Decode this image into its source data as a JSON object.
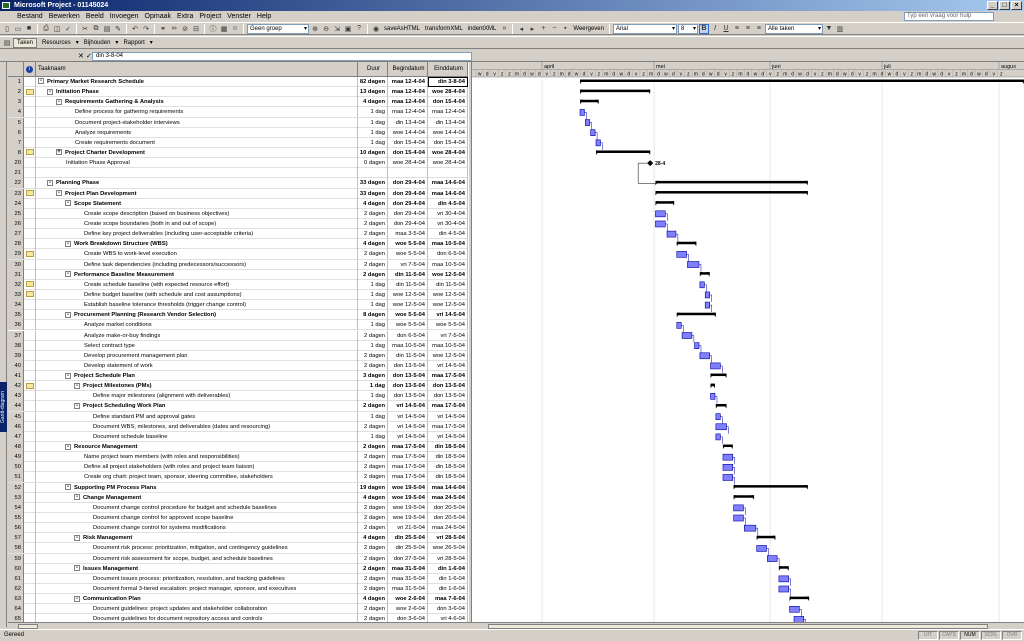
{
  "window": {
    "title": "Microsoft Project - 01145024"
  },
  "menu": [
    "Bestand",
    "Bewerken",
    "Beeld",
    "Invoegen",
    "Opmaak",
    "Extra",
    "Project",
    "Venster",
    "Help"
  ],
  "help_placeholder": "Typ een vraag voor hulp",
  "toolbar": {
    "group_combo": "Geen groep",
    "macros": [
      "saveAsHTML",
      "transformXML",
      "indentXML"
    ],
    "show_label": "Weergeven",
    "font": "Arial",
    "size": "8",
    "filter_combo": "Alle taken"
  },
  "view_toolbar": [
    "Taken",
    "Resources",
    "Bijhouden",
    "Rapport"
  ],
  "edit_value": "din 3-8-04",
  "view_label": "Gantt-diagram",
  "columns": {
    "name": "Taaknaam",
    "duration": "Duur",
    "start": "Begindatum",
    "finish": "Einddatum"
  },
  "timescale": {
    "months": [
      "april",
      "mei",
      "juni",
      "juli",
      "augus"
    ],
    "days": [
      "w",
      "d",
      "v",
      "z",
      "z",
      "m",
      "d",
      "w",
      "d",
      "v",
      "z",
      "m",
      "d",
      "w",
      "d",
      "v",
      "z",
      "m",
      "d",
      "w",
      "d",
      "v",
      "z",
      "m",
      "d",
      "w",
      "d",
      "v",
      "z",
      "m",
      "d",
      "w",
      "d",
      "v",
      "z",
      "m",
      "d",
      "w",
      "d",
      "v",
      "z",
      "m",
      "d",
      "w",
      "d",
      "v",
      "z",
      "m",
      "d",
      "w",
      "d",
      "v",
      "z",
      "m",
      "d",
      "w",
      "d",
      "v",
      "z",
      "m",
      "d",
      "w",
      "d",
      "v",
      "z",
      "m",
      "d",
      "w",
      "d",
      "v",
      "z"
    ]
  },
  "tasks": [
    {
      "id": "1",
      "lvl": 0,
      "sum": true,
      "tog": "-",
      "name": "Primary Market Research Schedule",
      "dur": "82 dagen",
      "start": "maa 12-4-04",
      "finish": "din 3-8-04",
      "sel": true,
      "b": 0,
      "e": 1.0
    },
    {
      "id": "2",
      "lvl": 1,
      "sum": true,
      "tog": "-",
      "note": true,
      "name": "Initiation Phase",
      "dur": "13 dagen",
      "start": "maa 12-4-04",
      "finish": "woe 28-4-04",
      "b": 0,
      "e": 0.158
    },
    {
      "id": "3",
      "lvl": 2,
      "sum": true,
      "tog": "-",
      "name": "Requirements Gathering & Analysis",
      "dur": "4 dagen",
      "start": "maa 12-4-04",
      "finish": "don 15-4-04",
      "b": 0,
      "e": 0.042
    },
    {
      "id": "4",
      "lvl": 3,
      "name": "Define process for gathering requirements",
      "dur": "1 dag",
      "start": "maa 12-4-04",
      "finish": "maa 12-4-04",
      "b": 0,
      "e": 0.01
    },
    {
      "id": "5",
      "lvl": 3,
      "name": "Document project-stakeholder interviews",
      "dur": "1 dag",
      "start": "din 13-4-04",
      "finish": "din 13-4-04",
      "b": 0.012,
      "e": 0.022
    },
    {
      "id": "6",
      "lvl": 3,
      "name": "Analyze requirements",
      "dur": "1 dag",
      "start": "woe 14-4-04",
      "finish": "woe 14-4-04",
      "b": 0.024,
      "e": 0.034
    },
    {
      "id": "7",
      "lvl": 3,
      "name": "Create requirements document",
      "dur": "1 dag",
      "start": "don 15-4-04",
      "finish": "don 15-4-04",
      "b": 0.036,
      "e": 0.046
    },
    {
      "id": "8",
      "lvl": 2,
      "sum": true,
      "tog": "+",
      "note": true,
      "name": "Project Charter Development",
      "dur": "10 dagen",
      "start": "don 15-4-04",
      "finish": "woe 28-4-04",
      "b": 0.036,
      "e": 0.158
    },
    {
      "id": "20",
      "lvl": 2,
      "name": "Initiation Phase Approval",
      "dur": "0 dagen",
      "start": "woe 28-4-04",
      "finish": "woe 28-4-04",
      "milestone": true,
      "mlabel": "28-4",
      "b": 0.158,
      "e": 0.158
    },
    {
      "id": "21",
      "lvl": 0,
      "name": "",
      "dur": "",
      "start": "",
      "finish": ""
    },
    {
      "id": "22",
      "lvl": 1,
      "sum": true,
      "tog": "-",
      "name": "Planning Phase",
      "dur": "33 dagen",
      "start": "don 29-4-04",
      "finish": "maa 14-6-04",
      "b": 0.17,
      "e": 0.513
    },
    {
      "id": "23",
      "lvl": 2,
      "sum": true,
      "tog": "-",
      "note": true,
      "name": "Project Plan Development",
      "dur": "33 dagen",
      "start": "don 29-4-04",
      "finish": "maa 14-6-04",
      "b": 0.17,
      "e": 0.513
    },
    {
      "id": "24",
      "lvl": 3,
      "sum": true,
      "tog": "-",
      "name": "Scope Statement",
      "dur": "4 dagen",
      "start": "don 29-4-04",
      "finish": "din 4-5-04",
      "b": 0.17,
      "e": 0.212
    },
    {
      "id": "25",
      "lvl": 4,
      "name": "Create scope description (based on business objectives)",
      "dur": "2 dagen",
      "start": "don 29-4-04",
      "finish": "vri 30-4-04",
      "b": 0.17,
      "e": 0.192
    },
    {
      "id": "26",
      "lvl": 4,
      "name": "Create scope boundaries (both in and out of scope)",
      "dur": "2 dagen",
      "start": "don 29-4-04",
      "finish": "vri 30-4-04",
      "b": 0.17,
      "e": 0.192
    },
    {
      "id": "27",
      "lvl": 4,
      "name": "Define key project deliverables (including user-acceptable criteria)",
      "dur": "2 dagen",
      "start": "maa 3-5-04",
      "finish": "din 4-5-04",
      "b": 0.196,
      "e": 0.216
    },
    {
      "id": "28",
      "lvl": 3,
      "sum": true,
      "tog": "-",
      "name": "Work Breakdown Structure (WBS)",
      "dur": "4 dagen",
      "start": "woe 5-5-04",
      "finish": "maa 10-5-04",
      "b": 0.218,
      "e": 0.262
    },
    {
      "id": "29",
      "lvl": 4,
      "note": true,
      "name": "Create WBS to work-level execution",
      "dur": "2 dagen",
      "start": "woe 5-5-04",
      "finish": "don 6-5-04",
      "b": 0.218,
      "e": 0.24
    },
    {
      "id": "30",
      "lvl": 4,
      "name": "Define task dependencies (including predecessors/successors)",
      "dur": "2 dagen",
      "start": "vri 7-5-04",
      "finish": "maa 10-5-04",
      "b": 0.242,
      "e": 0.268
    },
    {
      "id": "31",
      "lvl": 3,
      "sum": true,
      "tog": "-",
      "name": "Performance Baseline Measurement",
      "dur": "2 dagen",
      "start": "din 11-5-04",
      "finish": "woe 12-5-04",
      "b": 0.27,
      "e": 0.292
    },
    {
      "id": "32",
      "lvl": 4,
      "note": true,
      "name": "Create schedule baseline (with expected resource effort)",
      "dur": "1 dag",
      "start": "din 11-5-04",
      "finish": "din 11-5-04",
      "b": 0.27,
      "e": 0.28
    },
    {
      "id": "33",
      "lvl": 4,
      "note": true,
      "name": "Define budget baseline (with schedule and cost assumptions)",
      "dur": "1 dag",
      "start": "woe 12-5-04",
      "finish": "woe 12-5-04",
      "b": 0.282,
      "e": 0.292
    },
    {
      "id": "34",
      "lvl": 4,
      "name": "Establish baseline tolerance thresholds (trigger change control)",
      "dur": "1 dag",
      "start": "woe 12-5-04",
      "finish": "woe 12-5-04",
      "b": 0.282,
      "e": 0.292
    },
    {
      "id": "35",
      "lvl": 3,
      "sum": true,
      "tog": "-",
      "name": "Procurement Planning (Research Vendor Selection)",
      "dur": "8 dagen",
      "start": "woe 5-5-04",
      "finish": "vri 14-5-04",
      "b": 0.218,
      "e": 0.306
    },
    {
      "id": "36",
      "lvl": 4,
      "name": "Analyze market conditions",
      "dur": "1 dag",
      "start": "woe 5-5-04",
      "finish": "woe 5-5-04",
      "b": 0.218,
      "e": 0.228
    },
    {
      "id": "37",
      "lvl": 4,
      "name": "Analyze make-or-buy findings",
      "dur": "2 dagen",
      "start": "don 6-5-04",
      "finish": "vri 7-5-04",
      "b": 0.23,
      "e": 0.252
    },
    {
      "id": "38",
      "lvl": 4,
      "name": "Select contract type",
      "dur": "1 dag",
      "start": "maa 10-5-04",
      "finish": "maa 10-5-04",
      "b": 0.258,
      "e": 0.268
    },
    {
      "id": "39",
      "lvl": 4,
      "name": "Develop procurement management plan",
      "dur": "2 dagen",
      "start": "din 11-5-04",
      "finish": "woe 12-5-04",
      "b": 0.27,
      "e": 0.292
    },
    {
      "id": "40",
      "lvl": 4,
      "name": "Develop statement of work",
      "dur": "2 dagen",
      "start": "don 13-5-04",
      "finish": "vri 14-5-04",
      "b": 0.294,
      "e": 0.316
    },
    {
      "id": "41",
      "lvl": 3,
      "sum": true,
      "tog": "-",
      "name": "Project Schedule Plan",
      "dur": "3 dagen",
      "start": "don 13-5-04",
      "finish": "maa 17-5-04",
      "b": 0.294,
      "e": 0.33
    },
    {
      "id": "42",
      "lvl": 4,
      "sum": true,
      "tog": "-",
      "note": true,
      "name": "Project Milestones (PMs)",
      "dur": "1 dag",
      "start": "don 13-5-04",
      "finish": "don 13-5-04",
      "b": 0.294,
      "e": 0.304
    },
    {
      "id": "43",
      "lvl": 5,
      "name": "Define major milestones (alignment with deliverables)",
      "dur": "1 dag",
      "start": "don 13-5-04",
      "finish": "don 13-5-04",
      "b": 0.294,
      "e": 0.304
    },
    {
      "id": "44",
      "lvl": 4,
      "sum": true,
      "tog": "-",
      "name": "Project Scheduling Work Plan",
      "dur": "2 dagen",
      "start": "vri 14-5-04",
      "finish": "maa 17-5-04",
      "b": 0.306,
      "e": 0.33
    },
    {
      "id": "45",
      "lvl": 5,
      "name": "Define standard PM and approval gates",
      "dur": "1 dag",
      "start": "vri 14-5-04",
      "finish": "vri 14-5-04",
      "b": 0.306,
      "e": 0.316
    },
    {
      "id": "46",
      "lvl": 5,
      "name": "Document WBS, milestones, and deliverables (dates and resourcing)",
      "dur": "2 dagen",
      "start": "vri 14-5-04",
      "finish": "maa 17-5-04",
      "b": 0.306,
      "e": 0.33
    },
    {
      "id": "47",
      "lvl": 5,
      "name": "Document schedule baseline",
      "dur": "1 dag",
      "start": "vri 14-5-04",
      "finish": "vri 14-5-04",
      "b": 0.306,
      "e": 0.316
    },
    {
      "id": "48",
      "lvl": 3,
      "sum": true,
      "tog": "-",
      "name": "Resource Management",
      "dur": "2 dagen",
      "start": "maa 17-5-04",
      "finish": "din 18-5-04",
      "b": 0.322,
      "e": 0.344
    },
    {
      "id": "49",
      "lvl": 4,
      "name": "Name project team members (with roles and responsibilities)",
      "dur": "2 dagen",
      "start": "maa 17-5-04",
      "finish": "din 18-5-04",
      "b": 0.322,
      "e": 0.344
    },
    {
      "id": "50",
      "lvl": 4,
      "name": "Define all project stakeholders (with roles and project team liaison)",
      "dur": "2 dagen",
      "start": "maa 17-5-04",
      "finish": "din 18-5-04",
      "b": 0.322,
      "e": 0.344
    },
    {
      "id": "51",
      "lvl": 4,
      "name": "Create org chart: project team, sponsor, steering committee, stakeholders",
      "dur": "2 dagen",
      "start": "maa 17-5-04",
      "finish": "din 18-5-04",
      "b": 0.322,
      "e": 0.344
    },
    {
      "id": "52",
      "lvl": 3,
      "sum": true,
      "tog": "-",
      "name": "Supporting PM Process Plans",
      "dur": "19 dagen",
      "start": "woe 19-5-04",
      "finish": "maa 14-6-04",
      "b": 0.346,
      "e": 0.513
    },
    {
      "id": "53",
      "lvl": 4,
      "sum": true,
      "tog": "-",
      "name": "Change Management",
      "dur": "4 dagen",
      "start": "woe 19-5-04",
      "finish": "maa 24-5-04",
      "b": 0.346,
      "e": 0.392
    },
    {
      "id": "54",
      "lvl": 5,
      "name": "Document change control procedure for budget and schedule baselines",
      "dur": "2 dagen",
      "start": "woe 19-5-04",
      "finish": "don 20-5-04",
      "b": 0.346,
      "e": 0.368
    },
    {
      "id": "55",
      "lvl": 5,
      "name": "Document change control for approved scope baseline",
      "dur": "2 dagen",
      "start": "woe 19-5-04",
      "finish": "don 20-5-04",
      "b": 0.346,
      "e": 0.368
    },
    {
      "id": "56",
      "lvl": 5,
      "name": "Document change control for systems modifications",
      "dur": "2 dagen",
      "start": "vri 21-5-04",
      "finish": "maa 24-5-04",
      "b": 0.37,
      "e": 0.396
    },
    {
      "id": "57",
      "lvl": 4,
      "sum": true,
      "tog": "-",
      "name": "Risk Management",
      "dur": "4 dagen",
      "start": "din 25-5-04",
      "finish": "vri 28-5-04",
      "b": 0.398,
      "e": 0.44
    },
    {
      "id": "58",
      "lvl": 5,
      "name": "Document risk process: prioritization, mitigation, and contingency guidelines",
      "dur": "2 dagen",
      "start": "din 25-5-04",
      "finish": "woe 26-5-04",
      "b": 0.398,
      "e": 0.42
    },
    {
      "id": "59",
      "lvl": 5,
      "name": "Document risk assessment for scope, budget, and schedule baselines",
      "dur": "2 dagen",
      "start": "don 27-5-04",
      "finish": "vri 28-5-04",
      "b": 0.422,
      "e": 0.444
    },
    {
      "id": "60",
      "lvl": 4,
      "sum": true,
      "tog": "-",
      "name": "Issues Management",
      "dur": "2 dagen",
      "start": "maa 31-5-04",
      "finish": "din 1-6-04",
      "b": 0.448,
      "e": 0.47
    },
    {
      "id": "61",
      "lvl": 5,
      "name": "Document issues process: prioritization, resolution, and tracking guidelines",
      "dur": "2 dagen",
      "start": "maa 31-5-04",
      "finish": "din 1-6-04",
      "b": 0.448,
      "e": 0.47
    },
    {
      "id": "62",
      "lvl": 5,
      "name": "Document formal 3-tiered escalation: project manager, sponsor, and executives",
      "dur": "2 dagen",
      "start": "maa 31-5-04",
      "finish": "din 1-6-04",
      "b": 0.448,
      "e": 0.47
    },
    {
      "id": "63",
      "lvl": 4,
      "sum": true,
      "tog": "-",
      "name": "Communication Plan",
      "dur": "4 dagen",
      "start": "woe 2-6-04",
      "finish": "maa 7-6-04",
      "b": 0.472,
      "e": 0.516
    },
    {
      "id": "64",
      "lvl": 5,
      "name": "Document guidelines: project updates and stakeholder collaboration",
      "dur": "2 dagen",
      "start": "woe 2-6-04",
      "finish": "don 3-6-04",
      "b": 0.472,
      "e": 0.494
    },
    {
      "id": "65",
      "lvl": 5,
      "name": "Document guidelines for document repository access and controls",
      "dur": "2 dagen",
      "start": "don 3-6-04",
      "finish": "vri 4-6-04",
      "b": 0.482,
      "e": 0.504
    }
  ],
  "status": {
    "ready": "Gereed",
    "indicators": [
      {
        "t": "UIT",
        "on": false
      },
      {
        "t": "CAPS",
        "on": false
      },
      {
        "t": "NUM",
        "on": true
      },
      {
        "t": "SCRL",
        "on": false
      },
      {
        "t": "OVR",
        "on": false
      }
    ]
  }
}
